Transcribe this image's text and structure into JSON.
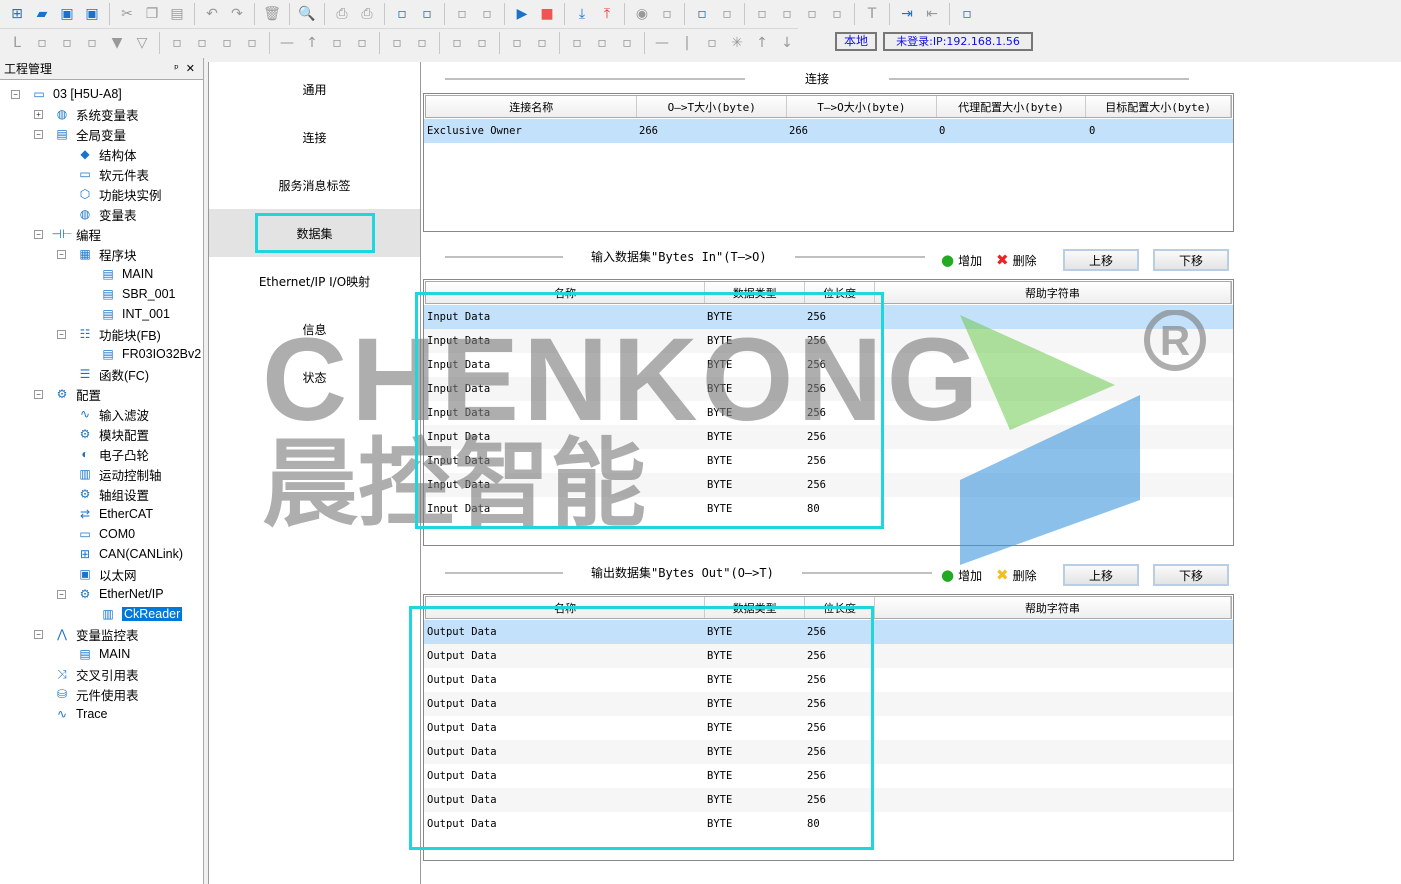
{
  "toolbar": {
    "row1": [
      "new-file",
      "open-folder",
      "save",
      "save-all",
      "|",
      "cut",
      "copy",
      "paste",
      "|",
      "undo",
      "redo",
      "|",
      "delete",
      "|",
      "search",
      "|",
      "print-preview",
      "print",
      "|",
      "cascade-windows",
      "tile-windows",
      "|",
      "compile",
      "compile-all",
      "|",
      "run",
      "stop",
      "|",
      "download",
      "upload",
      "|",
      "monitor",
      "trace",
      "|",
      "edit-online",
      "edit",
      "|",
      "ladder-a",
      "ladder-b",
      "ladder-c",
      "ladder-d",
      "|",
      "test",
      "|",
      "login",
      "logout",
      "|",
      "module-view"
    ],
    "row2": [
      "lad",
      "s-box",
      "s-box2",
      "branch",
      "arrow-down-fill",
      "arrow-down",
      "|",
      "contact-a",
      "contact-b",
      "contact-c",
      "contact-d",
      "|",
      "line-h",
      "line-up",
      "line-corner",
      "line-corner2",
      "|",
      "no-contact",
      "nc-contact",
      "|",
      "rise-contact",
      "fall-contact",
      "|",
      "set-coil",
      "coil-c",
      "|",
      "coil",
      "coil-a",
      "coil-f",
      "|",
      "hline",
      "vline",
      "cross-line",
      "cross-x",
      "arrow-up",
      "arrow-down2"
    ],
    "local_label": "本地",
    "login_status": "未登录:IP:192.168.1.56"
  },
  "project": {
    "title": "工程管理",
    "pin": "ᵖ",
    "close": "✕",
    "tree": [
      {
        "label": "03 [H5U-A8]",
        "icon": "▭",
        "depth": 0,
        "exp": "−"
      },
      {
        "label": "系统变量表",
        "icon": "◍",
        "depth": 1,
        "exp": "+"
      },
      {
        "label": "全局变量",
        "icon": "▤",
        "depth": 1,
        "exp": "−"
      },
      {
        "label": "结构体",
        "icon": "◆",
        "depth": 2
      },
      {
        "label": "软元件表",
        "icon": "▭",
        "depth": 2
      },
      {
        "label": "功能块实例",
        "icon": "⬡",
        "depth": 2
      },
      {
        "label": "变量表",
        "icon": "◍",
        "depth": 2
      },
      {
        "label": "编程",
        "icon": "⊣⊢",
        "depth": 1,
        "exp": "−"
      },
      {
        "label": "程序块",
        "icon": "▦",
        "depth": 2,
        "exp": "−"
      },
      {
        "label": "MAIN",
        "icon": "▤",
        "depth": 3
      },
      {
        "label": "SBR_001",
        "icon": "▤",
        "depth": 3
      },
      {
        "label": "INT_001",
        "icon": "▤",
        "depth": 3
      },
      {
        "label": "功能块(FB)",
        "icon": "☷",
        "depth": 2,
        "exp": "−"
      },
      {
        "label": "FR03IO32Bv2",
        "icon": "▤",
        "depth": 3
      },
      {
        "label": "函数(FC)",
        "icon": "☰",
        "depth": 2
      },
      {
        "label": "配置",
        "icon": "⚙",
        "depth": 1,
        "exp": "−"
      },
      {
        "label": "输入滤波",
        "icon": "∿",
        "depth": 2
      },
      {
        "label": "模块配置",
        "icon": "⚙",
        "depth": 2
      },
      {
        "label": "电子凸轮",
        "icon": "◐",
        "depth": 2
      },
      {
        "label": "运动控制轴",
        "icon": "▥",
        "depth": 2
      },
      {
        "label": "轴组设置",
        "icon": "⚙",
        "depth": 2
      },
      {
        "label": "EtherCAT",
        "icon": "⇄",
        "depth": 2
      },
      {
        "label": "COM0",
        "icon": "▭",
        "depth": 2
      },
      {
        "label": "CAN(CANLink)",
        "icon": "⊞",
        "depth": 2
      },
      {
        "label": "以太网",
        "icon": "▣",
        "depth": 2
      },
      {
        "label": "EtherNet/IP",
        "icon": "⚙",
        "depth": 2,
        "exp": "−"
      },
      {
        "label": "CkReader",
        "icon": "▥",
        "depth": 3,
        "selected": true
      },
      {
        "label": "变量监控表",
        "icon": "⋀",
        "depth": 1,
        "exp": "−"
      },
      {
        "label": "MAIN",
        "icon": "▤",
        "depth": 2
      },
      {
        "label": "交叉引用表",
        "icon": "⤨",
        "depth": 1
      },
      {
        "label": "元件使用表",
        "icon": "⛁",
        "depth": 1
      },
      {
        "label": "Trace",
        "icon": "∿",
        "depth": 1
      }
    ]
  },
  "nav": {
    "items": [
      "通用",
      "连接",
      "服务消息标签",
      "数据集",
      "Ethernet/IP I/O映射",
      "信息",
      "状态"
    ],
    "selected": 3
  },
  "connection": {
    "title": "连接",
    "columns": [
      "连接名称",
      "O—>T大小(byte)",
      "T—>O大小(byte)",
      "代理配置大小(byte)",
      "目标配置大小(byte)"
    ],
    "rows": [
      [
        "Exclusive Owner",
        "266",
        "266",
        "0",
        "0"
      ]
    ]
  },
  "input": {
    "title": "输入数据集\"Bytes In\"(T—>O)",
    "add": "增加",
    "delete": "删除",
    "up": "上移",
    "down": "下移",
    "columns": [
      "名称",
      "数据类型",
      "位长度",
      "帮助字符串"
    ],
    "rows": [
      [
        "Input Data",
        "BYTE",
        "256",
        ""
      ],
      [
        "Input Data",
        "BYTE",
        "256",
        ""
      ],
      [
        "Input Data",
        "BYTE",
        "256",
        ""
      ],
      [
        "Input Data",
        "BYTE",
        "256",
        ""
      ],
      [
        "Input Data",
        "BYTE",
        "256",
        ""
      ],
      [
        "Input Data",
        "BYTE",
        "256",
        ""
      ],
      [
        "Input Data",
        "BYTE",
        "256",
        ""
      ],
      [
        "Input Data",
        "BYTE",
        "256",
        ""
      ],
      [
        "Input Data",
        "BYTE",
        "80",
        ""
      ]
    ]
  },
  "output": {
    "title": "输出数据集\"Bytes Out\"(O—>T)",
    "add": "增加",
    "delete": "删除",
    "up": "上移",
    "down": "下移",
    "columns": [
      "名称",
      "数据类型",
      "位长度",
      "帮助字符串"
    ],
    "rows": [
      [
        "Output Data",
        "BYTE",
        "256",
        ""
      ],
      [
        "Output Data",
        "BYTE",
        "256",
        ""
      ],
      [
        "Output Data",
        "BYTE",
        "256",
        ""
      ],
      [
        "Output Data",
        "BYTE",
        "256",
        ""
      ],
      [
        "Output Data",
        "BYTE",
        "256",
        ""
      ],
      [
        "Output Data",
        "BYTE",
        "256",
        ""
      ],
      [
        "Output Data",
        "BYTE",
        "256",
        ""
      ],
      [
        "Output Data",
        "BYTE",
        "256",
        ""
      ],
      [
        "Output Data",
        "BYTE",
        "80",
        ""
      ]
    ]
  },
  "watermark": {
    "line1": "CHENKONG",
    "line2": "晨控智能",
    "reg": "®"
  },
  "colors": {
    "highlight": "#1fd6dc",
    "selected_row": "#c3e1fb",
    "tree_select": "#0078d7"
  }
}
